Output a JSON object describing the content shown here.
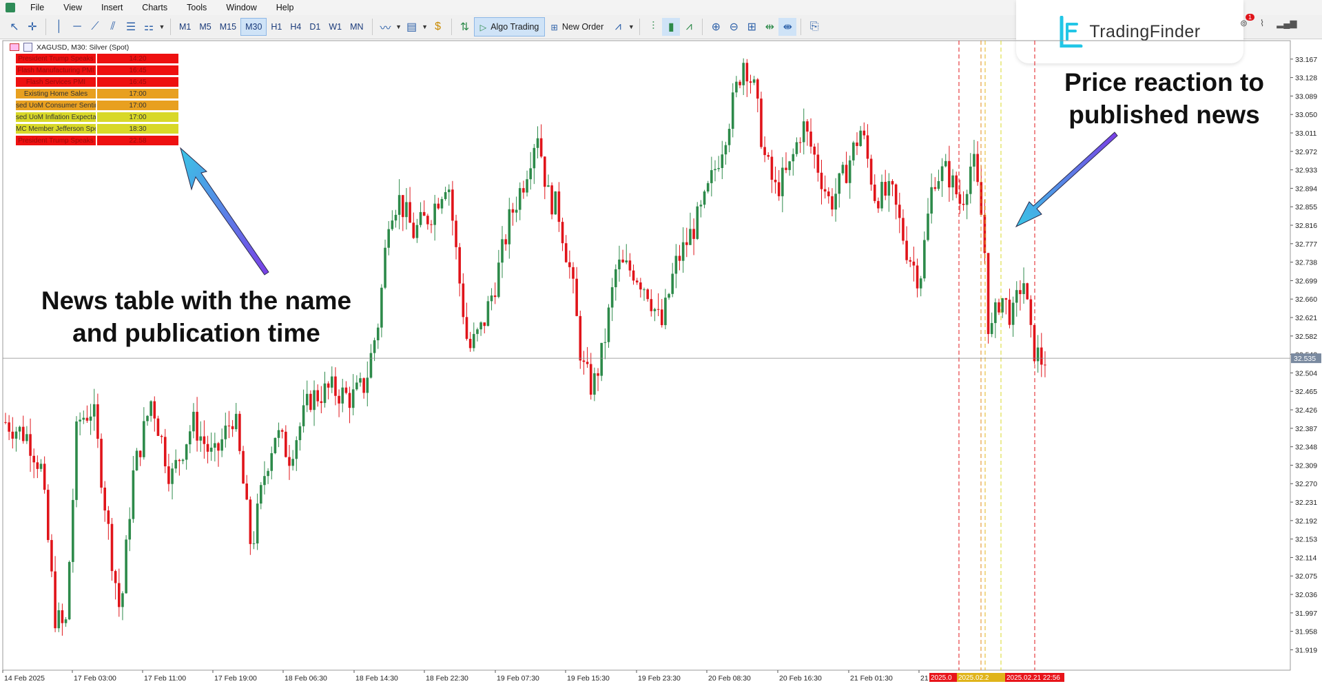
{
  "menu": [
    "File",
    "View",
    "Insert",
    "Charts",
    "Tools",
    "Window",
    "Help"
  ],
  "toolbar": {
    "timeframes": [
      "M1",
      "M5",
      "M15",
      "M30",
      "H1",
      "H4",
      "D1",
      "W1",
      "MN"
    ],
    "active_timeframe": "M30",
    "algo_trading": "Algo Trading",
    "new_order": "New Order"
  },
  "logo": {
    "text": "TradingFinder"
  },
  "notification_count": "1",
  "chart": {
    "symbol_line": "XAGUSD, M30:  Silver (Spot)",
    "current_price": "32.535",
    "current_price_value": 32.535,
    "price_min": 31.876,
    "price_max": 33.206,
    "price_ticks": [
      "33.167",
      "33.128",
      "33.089",
      "33.050",
      "33.011",
      "32.972",
      "32.933",
      "32.894",
      "32.855",
      "32.816",
      "32.777",
      "32.738",
      "32.699",
      "32.660",
      "32.621",
      "32.582",
      "32.543",
      "32.504",
      "32.465",
      "32.426",
      "32.387",
      "32.348",
      "32.309",
      "32.270",
      "32.231",
      "32.192",
      "32.153",
      "32.114",
      "32.075",
      "32.036",
      "31.997",
      "31.958",
      "31.919"
    ],
    "time_labels": [
      "14 Feb 2025",
      "17 Feb 03:00",
      "17 Feb 11:00",
      "17 Feb 19:00",
      "18 Feb 06:30",
      "18 Feb 14:30",
      "18 Feb 22:30",
      "19 Feb 07:30",
      "19 Feb 15:30",
      "19 Feb 23:30",
      "20 Feb 08:30",
      "20 Feb 16:30",
      "21 Feb 01:30",
      "21"
    ],
    "event_labels": [
      {
        "text": "2025.0",
        "color": "#e8141a"
      },
      {
        "text": "2025.02.2",
        "color": "#e0b41a"
      },
      {
        "text": "2025.02.21 22:56",
        "color": "#e8141a"
      }
    ],
    "colors": {
      "bull": "#2d8a4a",
      "bear": "#e0141a",
      "grid": "#ececec"
    }
  },
  "news_table": [
    {
      "name": "President Trump Speaks",
      "time": "14:20",
      "color": "#ee1010"
    },
    {
      "name": "Flash Manufacturing PMI",
      "time": "16:45",
      "color": "#ee1010"
    },
    {
      "name": "Flash Services PMI",
      "time": "16:45",
      "color": "#ee1010"
    },
    {
      "name": "Existing Home Sales",
      "time": "17:00",
      "color": "#e8a020"
    },
    {
      "name": "sed UoM Consumer Sentim",
      "time": "17:00",
      "color": "#e8a020"
    },
    {
      "name": "sed UoM Inflation Expectati",
      "time": "17:00",
      "color": "#d8d828"
    },
    {
      "name": "MC Member Jefferson Spea",
      "time": "18:30",
      "color": "#d8d828"
    },
    {
      "name": "President Trump Speaks",
      "time": "22:58",
      "color": "#ee1010"
    }
  ],
  "annotations": {
    "left": [
      "News table with the name",
      "and publication time"
    ],
    "right": [
      "Price reaction to",
      "published news"
    ]
  }
}
